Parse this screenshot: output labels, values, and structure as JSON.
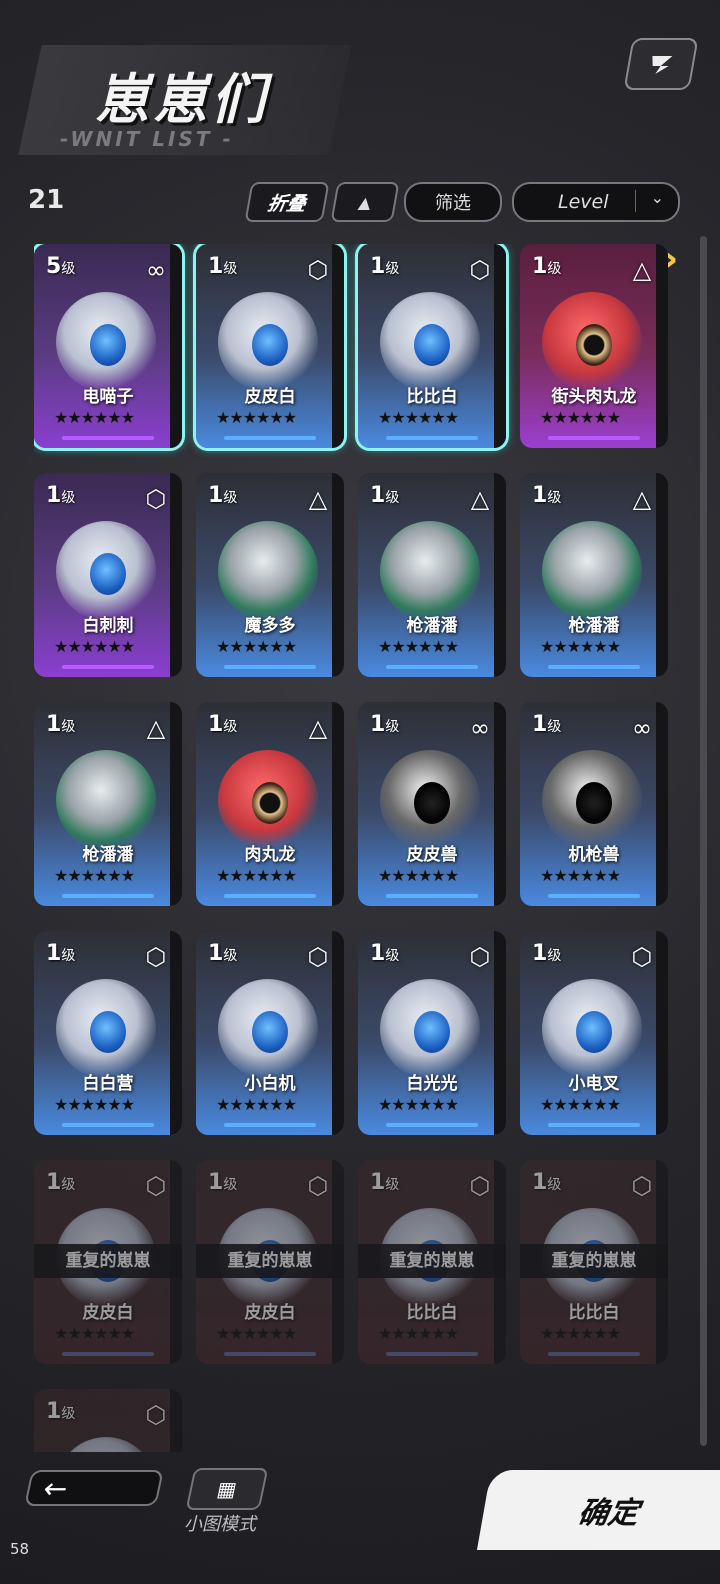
{
  "header": {
    "title": "崽崽们",
    "subtitle": "-WNIT LIST -",
    "share_icon": "share-arrow-icon"
  },
  "toolbar": {
    "count": "21",
    "fold_label": "折叠",
    "sort_icon": "▲",
    "filter_label": "筛选",
    "sort_select": "Level",
    "chevron": "⌄"
  },
  "colors": {
    "selected_outline": "#8ff3f0",
    "accent_arrow": "#f3c64a"
  },
  "cards": [
    {
      "level": "5",
      "level_unit": "级",
      "name": "电喵子",
      "type": "∞",
      "stars": "★★★★★★",
      "theme": "purple"
    },
    {
      "level": "1",
      "level_unit": "级",
      "name": "皮皮白",
      "type": "⬡",
      "stars": "★★★★★★",
      "theme": "blue"
    },
    {
      "level": "1",
      "level_unit": "级",
      "name": "比比白",
      "type": "⬡",
      "stars": "★★★★★★",
      "theme": "blue"
    },
    {
      "level": "1",
      "level_unit": "级",
      "name": "街头肉丸龙",
      "type": "△",
      "stars": "★★★★★★",
      "theme": "redp"
    },
    {
      "level": "1",
      "level_unit": "级",
      "name": "白刺刺",
      "type": "⬡",
      "stars": "★★★★★★",
      "theme": "purple"
    },
    {
      "level": "1",
      "level_unit": "级",
      "name": "魔多多",
      "type": "△",
      "stars": "★★★★★★",
      "theme": "blue"
    },
    {
      "level": "1",
      "level_unit": "级",
      "name": "枪潘潘",
      "type": "△",
      "stars": "★★★★★★",
      "theme": "blue"
    },
    {
      "level": "1",
      "level_unit": "级",
      "name": "枪潘潘",
      "type": "△",
      "stars": "★★★★★★",
      "theme": "blue"
    },
    {
      "level": "1",
      "level_unit": "级",
      "name": "枪潘潘",
      "type": "△",
      "stars": "★★★★★★",
      "theme": "blue"
    },
    {
      "level": "1",
      "level_unit": "级",
      "name": "肉丸龙",
      "type": "△",
      "stars": "★★★★★★",
      "theme": "blue"
    },
    {
      "level": "1",
      "level_unit": "级",
      "name": "皮皮兽",
      "type": "∞",
      "stars": "★★★★★★",
      "theme": "blue"
    },
    {
      "level": "1",
      "level_unit": "级",
      "name": "机枪兽",
      "type": "∞",
      "stars": "★★★★★★",
      "theme": "blue"
    },
    {
      "level": "1",
      "level_unit": "级",
      "name": "白白营",
      "type": "⬡",
      "stars": "★★★★★★",
      "theme": "blue"
    },
    {
      "level": "1",
      "level_unit": "级",
      "name": "小白机",
      "type": "⬡",
      "stars": "★★★★★★",
      "theme": "blue"
    },
    {
      "level": "1",
      "level_unit": "级",
      "name": "白光光",
      "type": "⬡",
      "stars": "★★★★★★",
      "theme": "blue"
    },
    {
      "level": "1",
      "level_unit": "级",
      "name": "小电叉",
      "type": "⬡",
      "stars": "★★★★★★",
      "theme": "blue"
    },
    {
      "level": "1",
      "level_unit": "级",
      "name": "皮皮白",
      "type": "⬡",
      "stars": "★★★★★★",
      "theme": "dup",
      "dup_label": "重复的崽崽"
    },
    {
      "level": "1",
      "level_unit": "级",
      "name": "皮皮白",
      "type": "⬡",
      "stars": "★★★★★★",
      "theme": "dup",
      "dup_label": "重复的崽崽"
    },
    {
      "level": "1",
      "level_unit": "级",
      "name": "比比白",
      "type": "⬡",
      "stars": "★★★★★★",
      "theme": "dup",
      "dup_label": "重复的崽崽"
    },
    {
      "level": "1",
      "level_unit": "级",
      "name": "比比白",
      "type": "⬡",
      "stars": "★★★★★★",
      "theme": "dup",
      "dup_label": "重复的崽崽"
    },
    {
      "level": "1",
      "level_unit": "级",
      "name": "",
      "type": "⬡",
      "stars": "",
      "theme": "dup"
    }
  ],
  "footer": {
    "back_icon": "←",
    "mini_icon": "▦",
    "mini_label": "小图模式",
    "confirm_label": "确定",
    "fps": "58"
  }
}
